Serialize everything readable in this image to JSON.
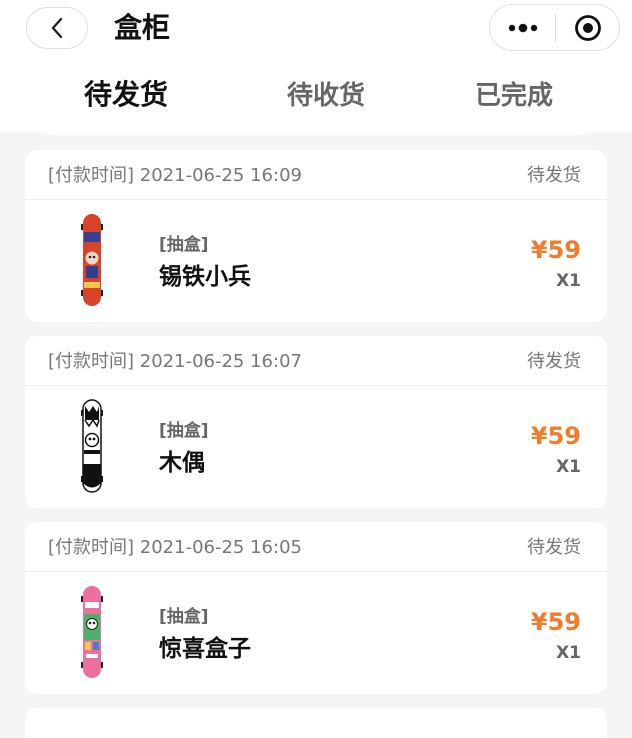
{
  "header": {
    "title": "盒柜",
    "back_icon": "chevron-left-icon",
    "more_icon": "more-dots-icon",
    "close_icon": "record-target-icon"
  },
  "tabs": [
    {
      "label": "待发货",
      "active": true
    },
    {
      "label": "待收货",
      "active": false
    },
    {
      "label": "已完成",
      "active": false
    }
  ],
  "orders": [
    {
      "pay_time": "[付款时间] 2021-06-25 16:09",
      "status": "待发货",
      "tag": "[抽盒]",
      "name": "锡铁小兵",
      "price": "¥59",
      "qty": "X1",
      "thumb_icon": "skateboard-red-icon"
    },
    {
      "pay_time": "[付款时间] 2021-06-25 16:07",
      "status": "待发货",
      "tag": "[抽盒]",
      "name": "木偶",
      "price": "¥59",
      "qty": "X1",
      "thumb_icon": "skateboard-puppet-icon"
    },
    {
      "pay_time": "[付款时间] 2021-06-25 16:05",
      "status": "待发货",
      "tag": "[抽盒]",
      "name": "惊喜盒子",
      "price": "¥59",
      "qty": "X1",
      "thumb_icon": "skateboard-pink-icon"
    }
  ],
  "colors": {
    "price": "#f07d2e",
    "background": "#f5f5f5"
  }
}
